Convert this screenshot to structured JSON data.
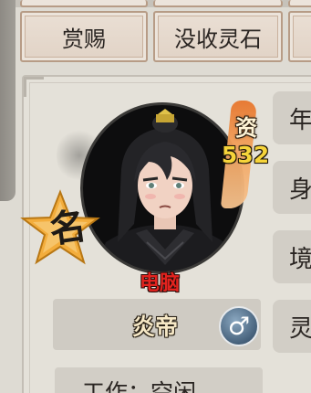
{
  "tabs": {
    "reward_label": "赏赐",
    "confiscate_label": "没收灵石"
  },
  "side_labels": [
    "年",
    "身",
    "境",
    "灵"
  ],
  "character": {
    "aptitude_label": "资",
    "aptitude_value": "532",
    "badge_text": "名",
    "tag": "电脑",
    "name": "炎帝",
    "gender_symbol": "♂",
    "work_text": "工作：空闲"
  },
  "colors": {
    "tag": "#e2231f",
    "aptitude_value": "#f6d43a",
    "badge_star": "#f3ad3c"
  }
}
